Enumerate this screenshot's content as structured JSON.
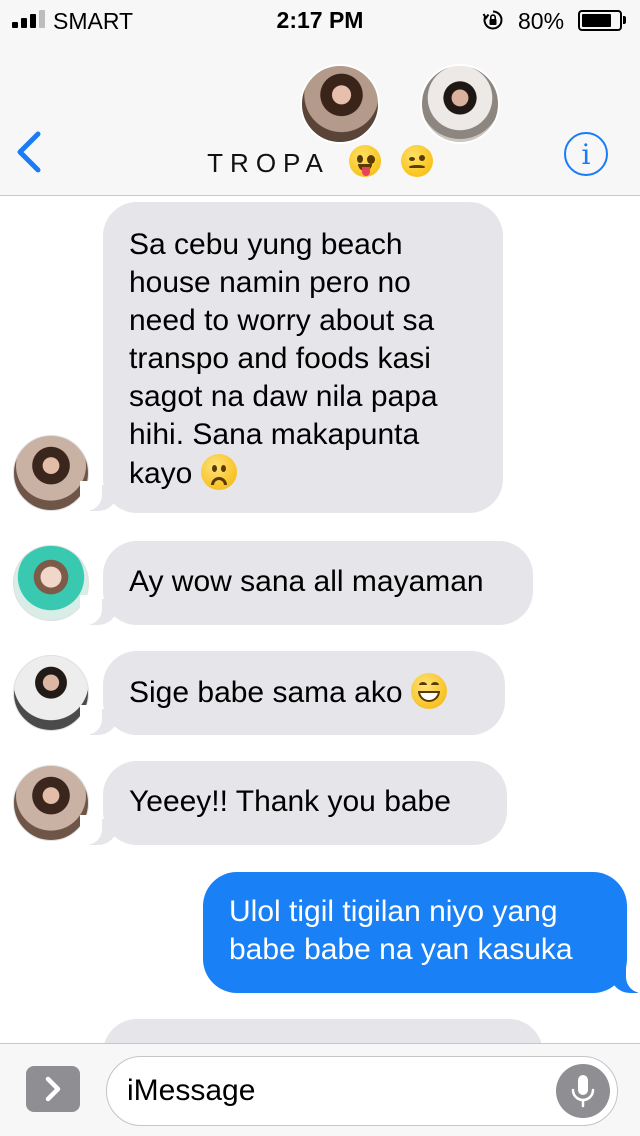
{
  "status_bar": {
    "carrier": "SMART",
    "time": "2:17 PM",
    "battery_percent": "80%",
    "battery_level": 0.8,
    "icons": [
      "signal-icon",
      "orientation-lock-icon",
      "battery-icon"
    ]
  },
  "header": {
    "group_name": "TROPA",
    "emoji": [
      "zany-face",
      "woozy-face"
    ],
    "icons": [
      "back-chevron-icon",
      "info-icon"
    ],
    "accent_color": "#1a7cf5"
  },
  "messages": [
    {
      "direction": "incoming",
      "lines": [
        "Sa cebu yung beach",
        "house namin pero no",
        "need to worry about sa",
        "transpo and foods kasi",
        "sagot na daw nila papa",
        "hihi. Sana makapunta",
        "kayo"
      ],
      "trailing_emoji": "frowning-face"
    },
    {
      "direction": "incoming",
      "lines": [
        "Ay wow sana all mayaman"
      ]
    },
    {
      "direction": "incoming",
      "lines": [
        "Sige babe sama ako"
      ],
      "trailing_emoji": "grinning-face"
    },
    {
      "direction": "incoming",
      "lines": [
        "Yeeey!! Thank you babe"
      ]
    },
    {
      "direction": "outgoing",
      "lines": [
        "Ulol tigil tigilan niyo yang",
        "babe babe na yan kasuka"
      ]
    }
  ],
  "compose": {
    "placeholder": "iMessage",
    "icons": [
      "app-drawer-chevron-icon",
      "microphone-icon"
    ]
  },
  "colors": {
    "incoming_bubble": "#e5e5ea",
    "outgoing_bubble": "#1a80f6",
    "bar_background": "#f7f7f7"
  }
}
